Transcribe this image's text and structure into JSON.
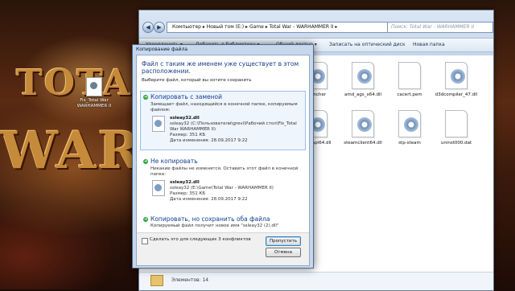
{
  "desktop": {
    "wallpaper_text_1": "TOTAL",
    "wallpaper_text_2": "WAR",
    "icon_label": "Fix_Total War WARHAMMER II"
  },
  "explorer": {
    "address": "Компьютер  ▸  Новый том (E:)  ▸  Game  ▸  Total War - WARHAMMER II  ▸",
    "search_placeholder": "Поиск: Total War - WARHAMMER II",
    "toolbar": {
      "organize": "Упорядочить ▾",
      "add_library": "Добавить в библиотеку ▾",
      "share": "Общий доступ ▾",
      "burn": "Записать на оптический диск",
      "new_folder": "Новая папка"
    },
    "files": [
      {
        "name": "...uncher",
        "type": "exe"
      },
      {
        "name": "amd_ags_x64.dll",
        "type": "dll"
      },
      {
        "name": "cacert.pem",
        "type": "doc"
      },
      {
        "name": "d3dcompiler_47.dll",
        "type": "dll"
      },
      {
        "name": "...m_api64.dll",
        "type": "dll"
      },
      {
        "name": "steamclient64.dll",
        "type": "dll"
      },
      {
        "name": "stp-steam",
        "type": "dll"
      },
      {
        "name": "uninst000.dat",
        "type": "doc"
      }
    ],
    "status": "Элементов: 14"
  },
  "dialog": {
    "title": "Копирование файла",
    "heading": "Файл с таким же именем уже существует в этом расположении.",
    "subheading": "Выберите файл, который вы хотите сохранить",
    "option_replace": {
      "title": "Копировать с заменой",
      "desc": "Замещает файл, находящийся в конечной папке, копируемым файлом:",
      "file_name": "ssleay32.dll",
      "file_path": "ssleay32 (C:\\Пользователи\\grevi\\Рабочий стол\\Fix_Total War WARHAMMER II)",
      "file_size": "Размер: 351 КБ",
      "file_date": "Дата изменения: 28.09.2017 9:22"
    },
    "option_skip": {
      "title": "Не копировать",
      "desc": "Никакие файлы не изменятся. Оставить этот файл в конечной папке:",
      "file_name": "ssleay32.dll",
      "file_path": "ssleay32 (E:\\Game\\Total War - WARHAMMER II)",
      "file_size": "Размер: 351 КБ",
      "file_date": "Дата изменения: 28.09.2017 9:22"
    },
    "option_keep_both": {
      "title": "Копировать, но сохранить оба файла",
      "desc": "Копируемый файл получит новое имя \"ssleay32 (2).dll\""
    },
    "checkbox_label": "Сделать это для следующих 3 конфликтов",
    "skip_button": "Пропустить",
    "cancel_button": "Отмена"
  }
}
